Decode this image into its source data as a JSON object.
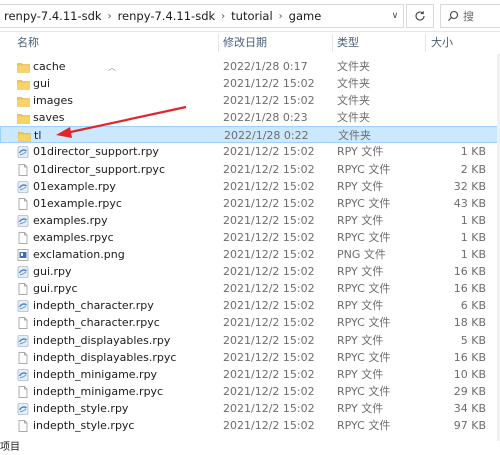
{
  "breadcrumb": [
    "renpy-7.4.11-sdk",
    "renpy-7.4.11-sdk",
    "tutorial",
    "game"
  ],
  "search": {
    "placeholder": "搜"
  },
  "columns": {
    "name": "名称",
    "modified": "修改日期",
    "type": "类型",
    "size": "大小"
  },
  "files": [
    {
      "name": "cache",
      "date": "2022/1/28 0:17",
      "type": "文件夹",
      "size": "",
      "icon": "folder"
    },
    {
      "name": "gui",
      "date": "2021/12/2 15:02",
      "type": "文件夹",
      "size": "",
      "icon": "folder"
    },
    {
      "name": "images",
      "date": "2021/12/2 15:02",
      "type": "文件夹",
      "size": "",
      "icon": "folder"
    },
    {
      "name": "saves",
      "date": "2022/1/28 0:23",
      "type": "文件夹",
      "size": "",
      "icon": "folder"
    },
    {
      "name": "tl",
      "date": "2022/1/28 0:22",
      "type": "文件夹",
      "size": "",
      "icon": "folder",
      "selected": true
    },
    {
      "name": "01director_support.rpy",
      "date": "2021/12/2 15:02",
      "type": "RPY 文件",
      "size": "1 KB",
      "icon": "rpy"
    },
    {
      "name": "01director_support.rpyc",
      "date": "2021/12/2 15:02",
      "type": "RPYC 文件",
      "size": "2 KB",
      "icon": "rpyc"
    },
    {
      "name": "01example.rpy",
      "date": "2021/12/2 15:02",
      "type": "RPY 文件",
      "size": "32 KB",
      "icon": "rpy"
    },
    {
      "name": "01example.rpyc",
      "date": "2021/12/2 15:02",
      "type": "RPYC 文件",
      "size": "43 KB",
      "icon": "rpyc"
    },
    {
      "name": "examples.rpy",
      "date": "2021/12/2 15:02",
      "type": "RPY 文件",
      "size": "1 KB",
      "icon": "rpy"
    },
    {
      "name": "examples.rpyc",
      "date": "2021/12/2 15:02",
      "type": "RPYC 文件",
      "size": "1 KB",
      "icon": "rpyc"
    },
    {
      "name": "exclamation.png",
      "date": "2021/12/2 15:02",
      "type": "PNG 文件",
      "size": "1 KB",
      "icon": "png"
    },
    {
      "name": "gui.rpy",
      "date": "2021/12/2 15:02",
      "type": "RPY 文件",
      "size": "16 KB",
      "icon": "rpy"
    },
    {
      "name": "gui.rpyc",
      "date": "2021/12/2 15:02",
      "type": "RPYC 文件",
      "size": "16 KB",
      "icon": "rpyc"
    },
    {
      "name": "indepth_character.rpy",
      "date": "2021/12/2 15:02",
      "type": "RPY 文件",
      "size": "6 KB",
      "icon": "rpy"
    },
    {
      "name": "indepth_character.rpyc",
      "date": "2021/12/2 15:02",
      "type": "RPYC 文件",
      "size": "18 KB",
      "icon": "rpyc"
    },
    {
      "name": "indepth_displayables.rpy",
      "date": "2021/12/2 15:02",
      "type": "RPY 文件",
      "size": "5 KB",
      "icon": "rpy"
    },
    {
      "name": "indepth_displayables.rpyc",
      "date": "2021/12/2 15:02",
      "type": "RPYC 文件",
      "size": "16 KB",
      "icon": "rpyc"
    },
    {
      "name": "indepth_minigame.rpy",
      "date": "2021/12/2 15:02",
      "type": "RPY 文件",
      "size": "10 KB",
      "icon": "rpy"
    },
    {
      "name": "indepth_minigame.rpyc",
      "date": "2021/12/2 15:02",
      "type": "RPYC 文件",
      "size": "29 KB",
      "icon": "rpyc"
    },
    {
      "name": "indepth_style.rpy",
      "date": "2021/12/2 15:02",
      "type": "RPY 文件",
      "size": "34 KB",
      "icon": "rpy"
    },
    {
      "name": "indepth_style.rpyc",
      "date": "2021/12/2 15:02",
      "type": "RPYC 文件",
      "size": "97 KB",
      "icon": "rpyc"
    }
  ],
  "status": {
    "text": "项目"
  },
  "colors": {
    "folder": "#f1c44b",
    "selection": "#cce8ff",
    "annotation_arrow": "#e0262a",
    "header_text": "#4c607a"
  }
}
